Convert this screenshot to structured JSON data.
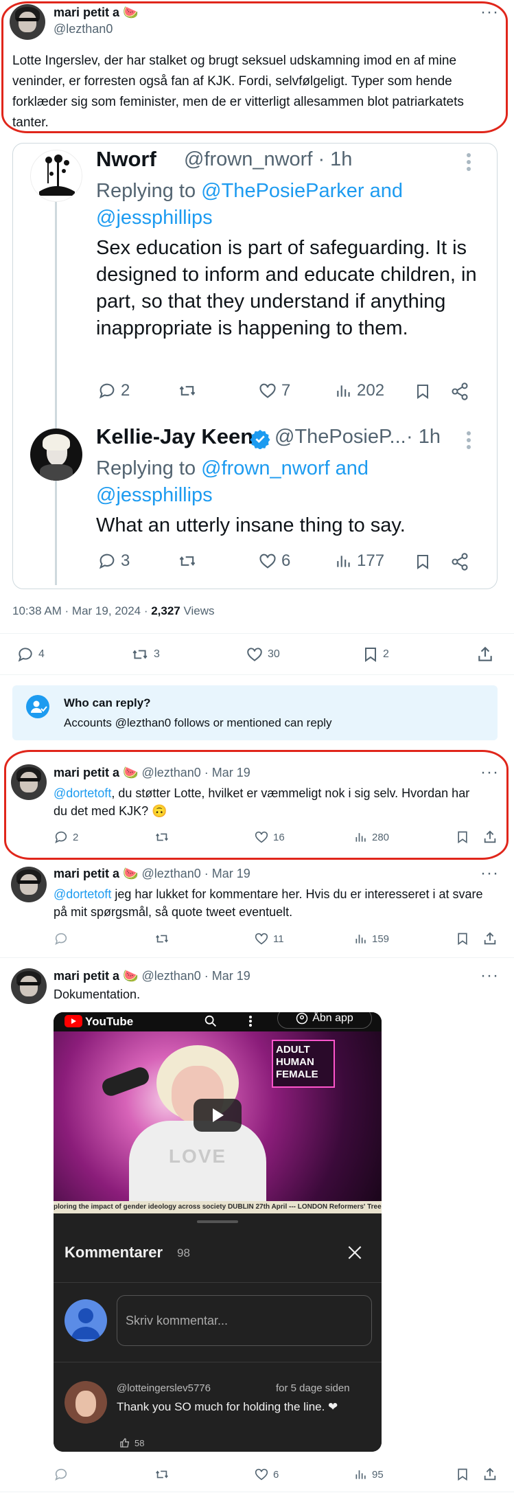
{
  "main_post": {
    "display_name": "mari petit a 🍉",
    "handle": "@lezthan0",
    "text": "Lotte Ingerslev, der har stalket og brugt seksuel udskamning imod en af mine veninder, er forresten også fan af KJK. Fordi, selvfølgeligt. Typer som hende forklæder sig som feminister, men de er vitterligt allesammen blot patriarkatets tanter.",
    "more": "···"
  },
  "quoted": {
    "tweet1": {
      "name": "Nworf",
      "handle": "@frown_nworf · 1h",
      "replying_prefix": "Replying to ",
      "replying_users": "@ThePosieParker and",
      "replying_users2": "@jessphillips",
      "text": "Sex education is part of safeguarding. It is designed to inform and educate children, in part, so that they understand if anything inappropriate is happening to them.",
      "replies": "2",
      "likes": "7",
      "views": "202"
    },
    "tweet2": {
      "name": "Kellie-Jay Keen",
      "handle": "@ThePosieP...",
      "time": "· 1h",
      "replying_prefix": "Replying to ",
      "replying_users": "@frown_nworf and",
      "replying_users2": "@jessphillips",
      "text": "What an utterly insane thing to say.",
      "replies": "3",
      "likes": "6",
      "views": "177"
    }
  },
  "timestamp_line": {
    "time": "10:38 AM · Mar 19, 2024 · ",
    "views_count": "2,327",
    "views_label": " Views"
  },
  "main_actions": {
    "replies": "4",
    "reposts": "3",
    "likes": "30",
    "bookmarks": "2"
  },
  "who_can_reply": {
    "title": "Who can reply?",
    "body": "Accounts @lezthan0 follows or mentioned can reply"
  },
  "replies": [
    {
      "name": "mari petit a 🍉",
      "meta": "@lezthan0 · Mar 19",
      "mention": "@dortetoft",
      "text": ", du støtter Lotte, hvilket er væmmeligt nok i sig selv. Hvordan har du det med KJK? 🙃",
      "replies": "2",
      "likes": "16",
      "views": "280"
    },
    {
      "name": "mari petit a 🍉",
      "meta": "@lezthan0 · Mar 19",
      "mention": "@dortetoft",
      "text": " jeg har lukket for kommentare her. Hvis du er interesseret i at svare på mit spørgsmål, så quote tweet eventuelt.",
      "replies": "",
      "likes": "11",
      "views": "159"
    },
    {
      "name": "mari petit a 🍉",
      "meta": "@lezthan0 · Mar 19",
      "text": "Dokumentation.",
      "replies": "",
      "likes": "6",
      "views": "95"
    }
  ],
  "video": {
    "yt_logo": "YouTube",
    "open_app": "Åbn app",
    "sign_top": "ADULT HUMAN FEMALE",
    "shirt": "LOVE",
    "ticker": "ploring the impact of gender ideology across society DUBLIN 27th April --- LONDON Reformers' Tree",
    "comments_title": "Kommentarer",
    "comments_count": "98",
    "comment_placeholder": "Skriv kommentar...",
    "commenter": "@lotteingerslev5776",
    "comment_time": "for 5 dage siden",
    "comment_text": "Thank you SO much for holding the line. ❤",
    "comment_likes": "58"
  },
  "colors": {
    "link": "#1d9bf0",
    "highlight": "#e0261b",
    "verified": "#1d9bf0"
  }
}
